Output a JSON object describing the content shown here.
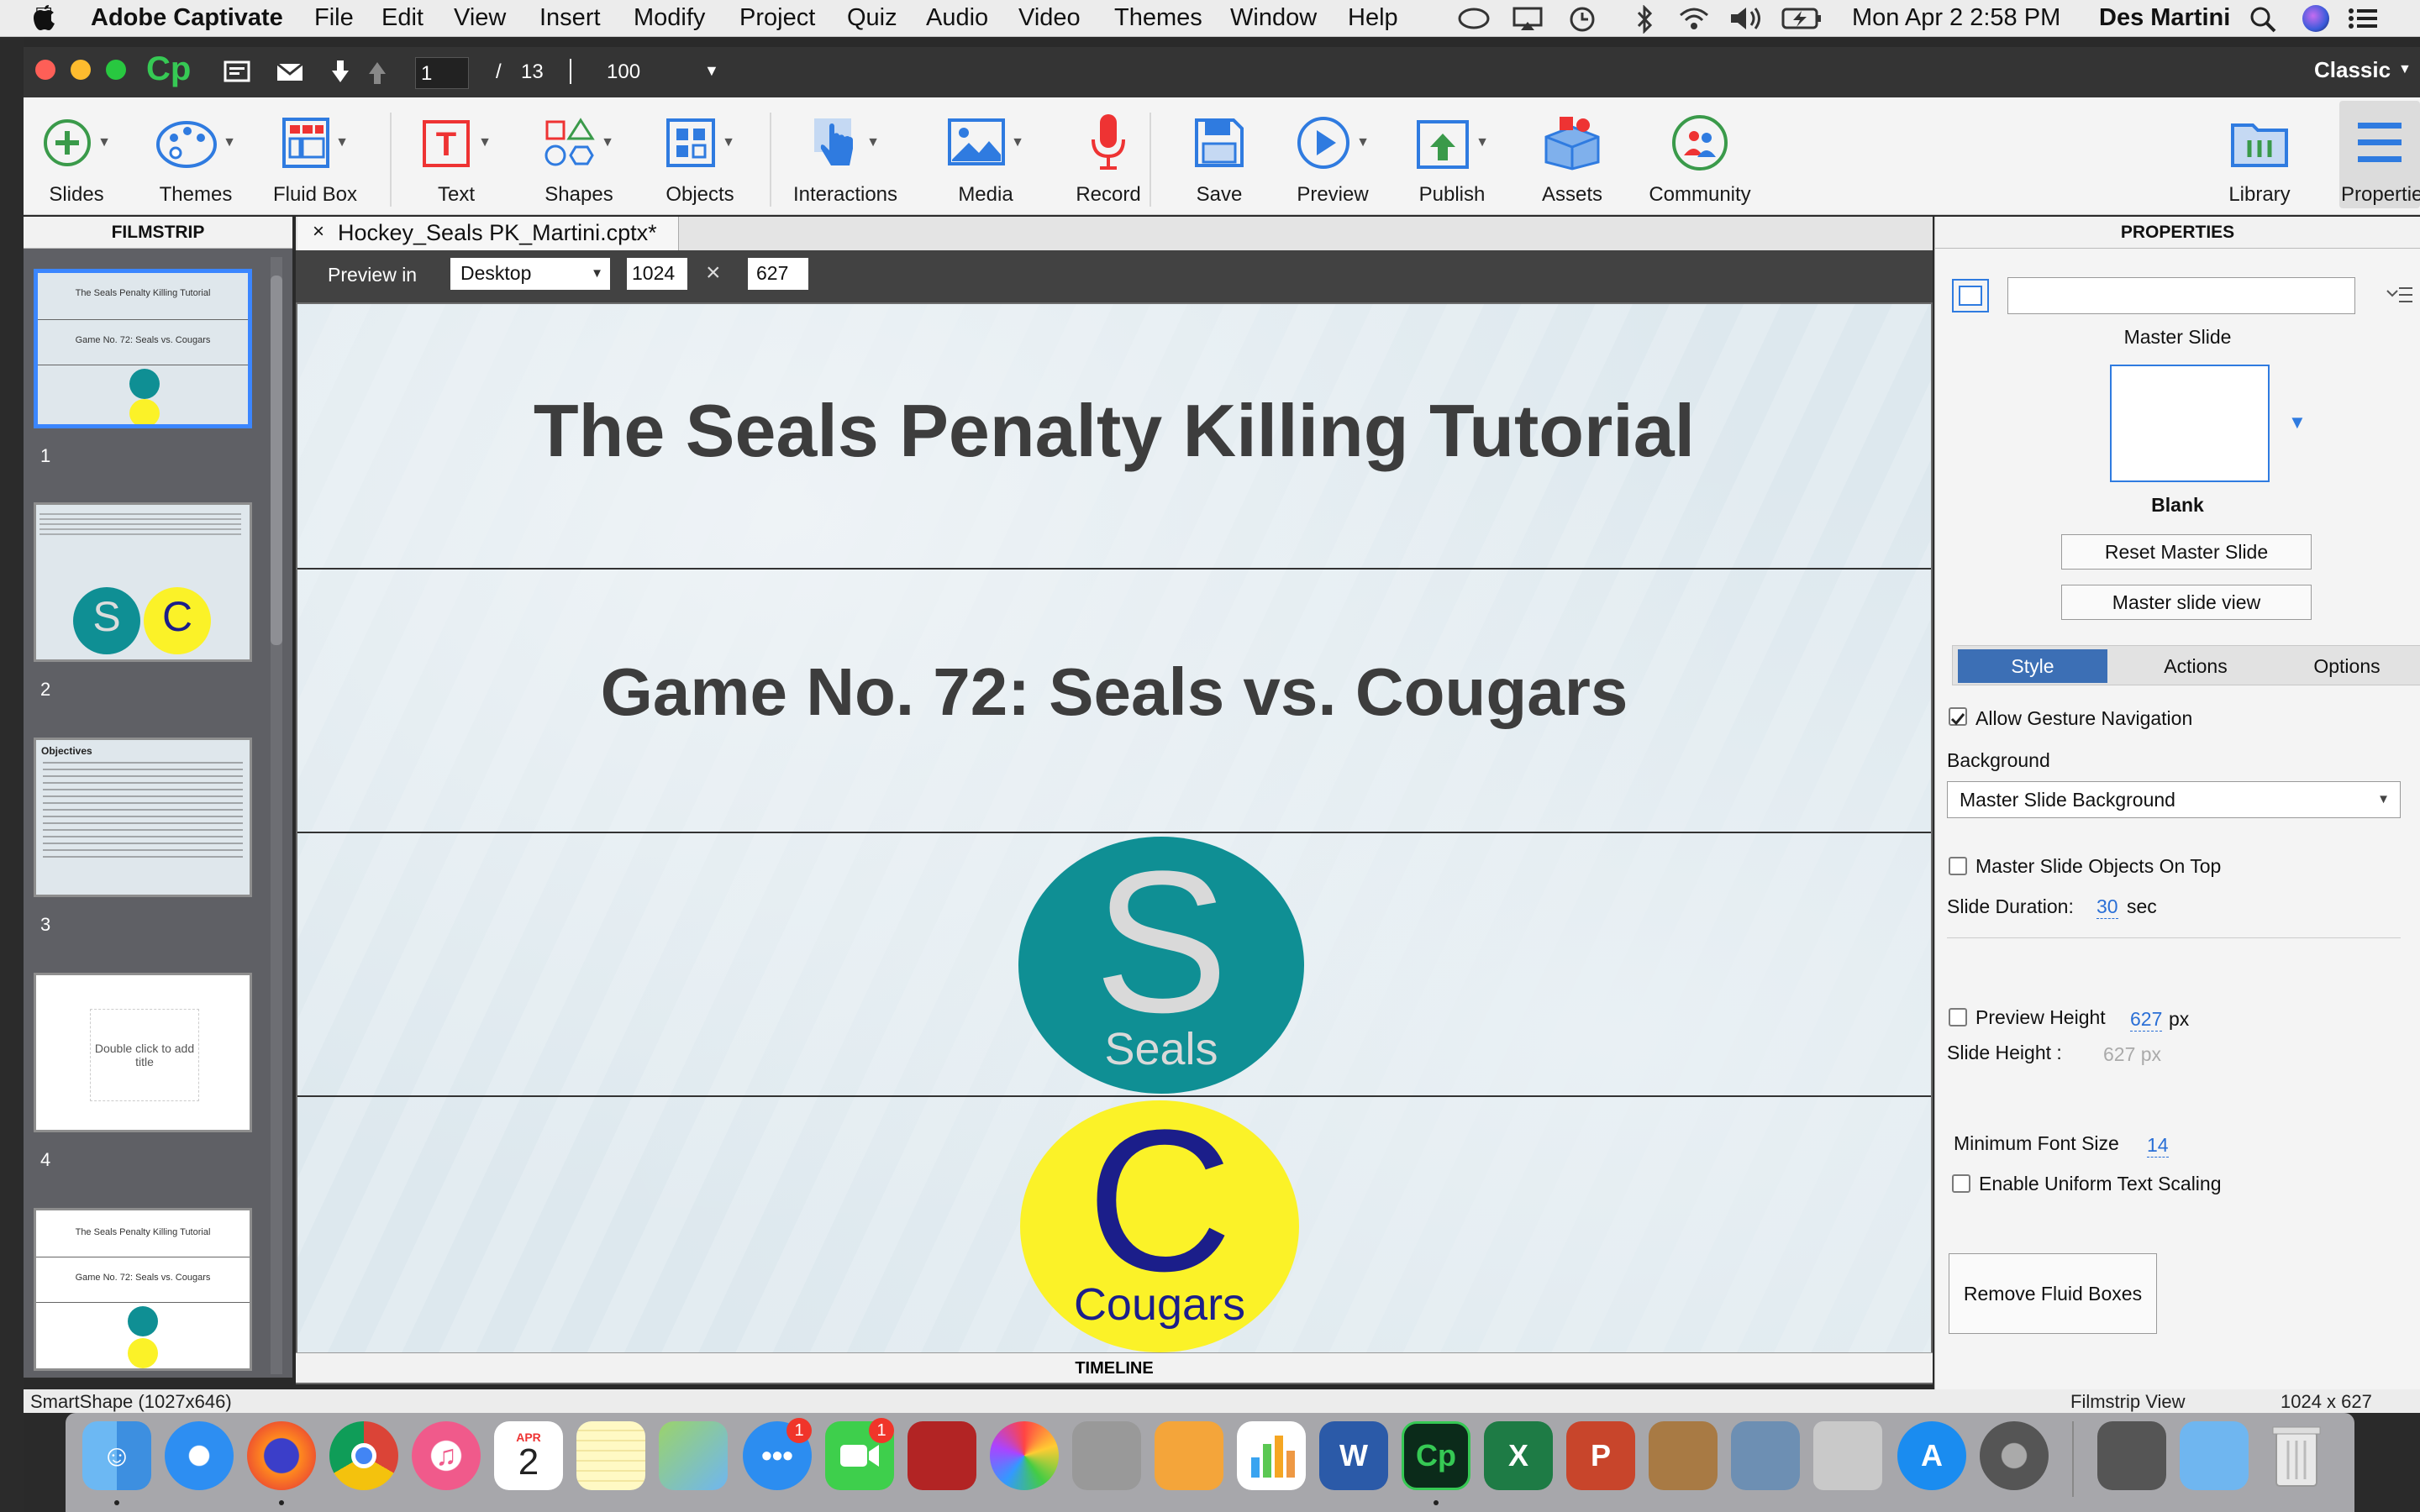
{
  "menubar": {
    "app_name": "Adobe Captivate",
    "menus": [
      "File",
      "Edit",
      "View",
      "Insert",
      "Modify",
      "Project",
      "Quiz",
      "Audio",
      "Video",
      "Themes",
      "Window",
      "Help"
    ],
    "clock": "Mon Apr 2  2:58 PM",
    "user": "Des Martini"
  },
  "titlebar": {
    "logo": "Cp",
    "page_current": "1",
    "page_sep": "/",
    "page_total": "13",
    "zoom": "100",
    "workspace": "Classic"
  },
  "toolbar": {
    "slides": "Slides",
    "themes": "Themes",
    "fluid_box": "Fluid Box",
    "text": "Text",
    "shapes": "Shapes",
    "objects": "Objects",
    "interactions": "Interactions",
    "media": "Media",
    "record": "Record",
    "save": "Save",
    "preview": "Preview",
    "publish": "Publish",
    "assets": "Assets",
    "community": "Community",
    "library": "Library",
    "properties": "Properties"
  },
  "filmstrip": {
    "header": "FILMSTRIP",
    "thumb_title": "The Seals Penalty Killing Tutorial",
    "thumb_subtitle": "Game No. 72: Seals vs. Cougars",
    "thumb3_heading": "Objectives",
    "thumb4_text": "Double click to add title",
    "numbers": [
      "1",
      "2",
      "3",
      "4"
    ]
  },
  "document": {
    "tab_close": "×",
    "tab_name": "Hockey_Seals PK_Martini.cptx*",
    "preview_in": "Preview in",
    "device": "Desktop",
    "width": "1024",
    "height": "627",
    "times": "×"
  },
  "slide": {
    "title": "The Seals Penalty Killing Tutorial",
    "subtitle": "Game No. 72: Seals vs. Cougars",
    "seals_letter": "S",
    "seals_name": "Seals",
    "cougars_letter": "C",
    "cougars_name": "Cougars"
  },
  "timeline": "TIMELINE",
  "status": {
    "left": "SmartShape (1027x646)",
    "view": "Filmstrip View",
    "size": "1024 x 627"
  },
  "properties": {
    "header": "PROPERTIES",
    "master_slide_label": "Master Slide",
    "master_name": "Blank",
    "reset_btn": "Reset Master Slide",
    "view_btn": "Master slide view",
    "tabs": [
      "Style",
      "Actions",
      "Options"
    ],
    "allow_gesture": "Allow Gesture Navigation",
    "background_label": "Background",
    "background_value": "Master Slide Background",
    "objects_on_top": "Master Slide Objects On Top",
    "duration_label": "Slide Duration:",
    "duration_value": "30",
    "duration_unit": "sec",
    "preview_height_label": "Preview Height",
    "preview_height_value": "627",
    "px": "px",
    "slide_height_label": "Slide Height :",
    "slide_height_value": "627 px",
    "min_font_label": "Minimum Font Size",
    "min_font_value": "14",
    "uniform_scaling": "Enable Uniform Text Scaling",
    "remove_btn": "Remove Fluid Boxes"
  },
  "dock": {
    "calendar_month": "APR",
    "calendar_day": "2",
    "badge_messages": "1",
    "badge_facetime": "1"
  },
  "colors": {
    "seals": "#0f8f94",
    "cougars": "#fbf228",
    "cougars_letter": "#1b1e8a",
    "accent_blue": "#2f7be0",
    "ice": "#dde8ee"
  }
}
